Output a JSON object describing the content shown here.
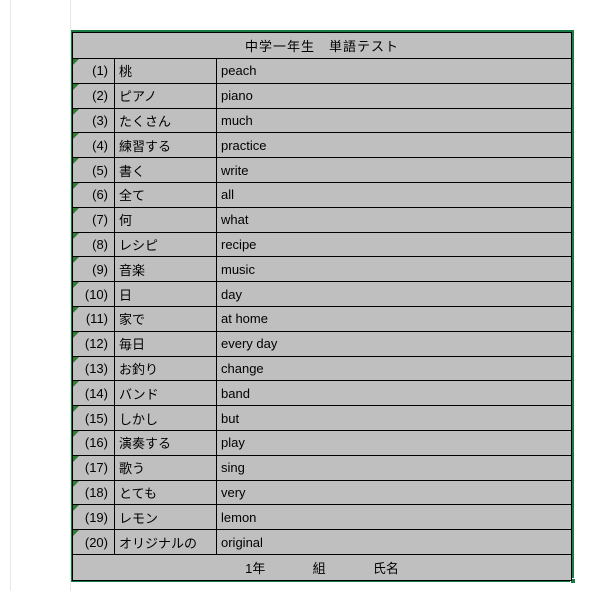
{
  "title": "中学一年生　単語テスト",
  "rows": [
    {
      "num": "(1)",
      "jp": "桃",
      "en": "peach"
    },
    {
      "num": "(2)",
      "jp": "ピアノ",
      "en": "piano"
    },
    {
      "num": "(3)",
      "jp": "たくさん",
      "en": "much"
    },
    {
      "num": "(4)",
      "jp": "練習する",
      "en": "practice"
    },
    {
      "num": "(5)",
      "jp": "書く",
      "en": "write"
    },
    {
      "num": "(6)",
      "jp": "全て",
      "en": "all"
    },
    {
      "num": "(7)",
      "jp": "何",
      "en": "what"
    },
    {
      "num": "(8)",
      "jp": "レシピ",
      "en": "recipe"
    },
    {
      "num": "(9)",
      "jp": "音楽",
      "en": "music"
    },
    {
      "num": "(10)",
      "jp": "日",
      "en": "day"
    },
    {
      "num": "(11)",
      "jp": "家で",
      "en": "at home"
    },
    {
      "num": "(12)",
      "jp": "毎日",
      "en": "every day"
    },
    {
      "num": "(13)",
      "jp": "お釣り",
      "en": "change"
    },
    {
      "num": "(14)",
      "jp": "バンド",
      "en": "band"
    },
    {
      "num": "(15)",
      "jp": "しかし",
      "en": "but"
    },
    {
      "num": "(16)",
      "jp": "演奏する",
      "en": "play"
    },
    {
      "num": "(17)",
      "jp": "歌う",
      "en": "sing"
    },
    {
      "num": "(18)",
      "jp": "とても",
      "en": "very"
    },
    {
      "num": "(19)",
      "jp": "レモン",
      "en": "lemon"
    },
    {
      "num": "(20)",
      "jp": "オリジナルの",
      "en": "original"
    }
  ],
  "footer": {
    "grade": "1年",
    "class_label": "組",
    "name_label": "氏名"
  }
}
